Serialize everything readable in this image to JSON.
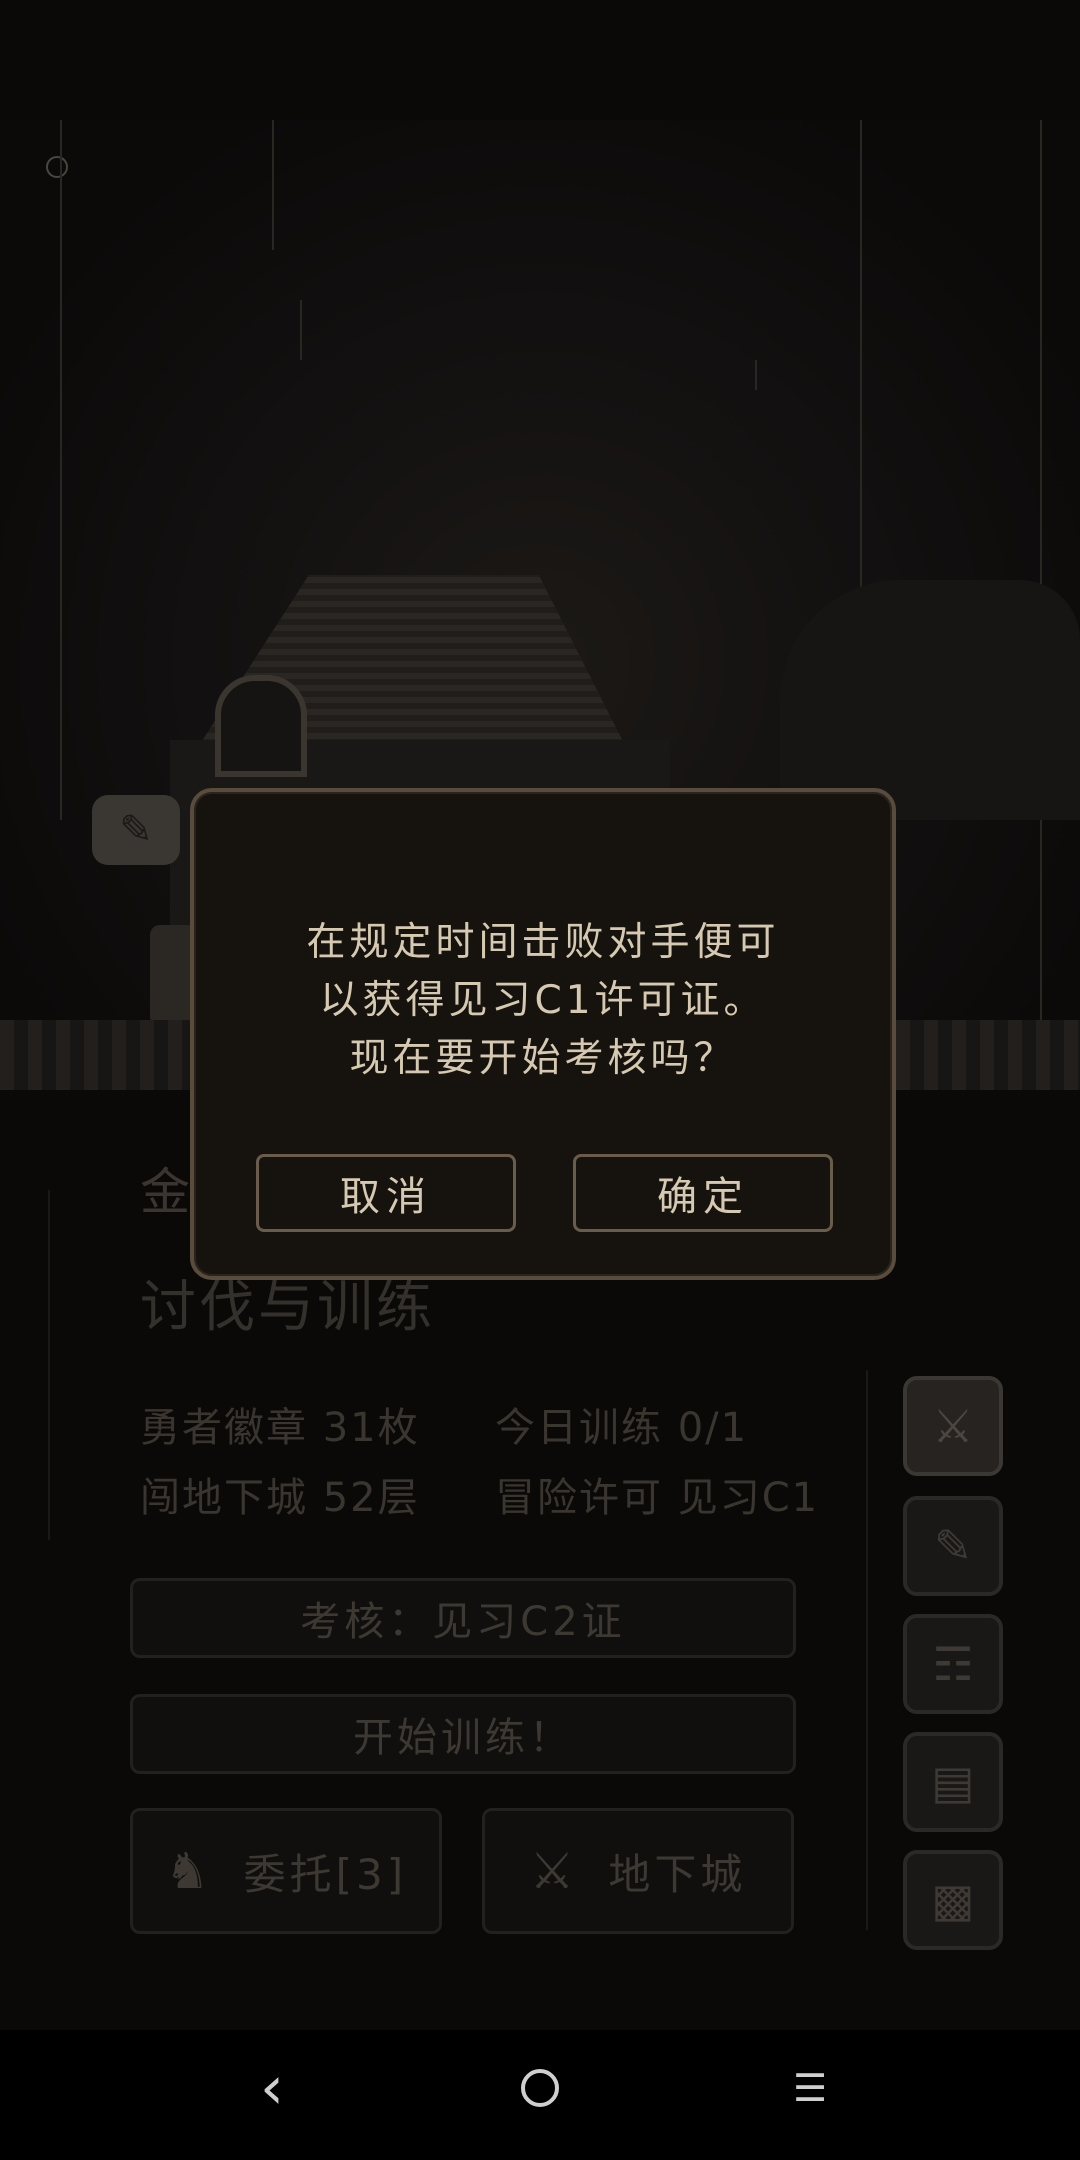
{
  "dialog": {
    "message_line1": "在规定时间击败对手便可",
    "message_line2": "以获得见习C1许可证。",
    "message_line3": "现在要开始考核吗？",
    "cancel_label": "取消",
    "confirm_label": "确定"
  },
  "background_panel": {
    "partial_label": "金",
    "title": "讨伐与训练",
    "stats": {
      "badges": "勇者徽章 31枚",
      "today_training": "今日训练 0/1",
      "dungeon_floor": "闯地下城 52层",
      "license": "冒险许可 见习C1"
    },
    "exam_button": "考核：见习C2证",
    "start_training_button": "开始训练！",
    "commission_button": "委托[3]",
    "dungeon_button": "地下城"
  },
  "side_menu": {
    "icons": [
      "crossed-swords-icon",
      "quill-paper-icon",
      "scroll-icon",
      "tablet-icon",
      "computer-icon"
    ]
  },
  "nav_bar": {
    "back": "‹",
    "menu": "☰"
  }
}
